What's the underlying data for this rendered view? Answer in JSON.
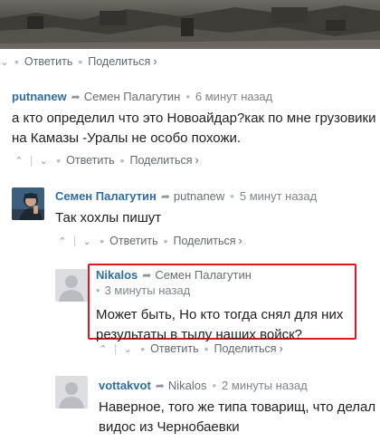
{
  "top_actions": {
    "reply": "Ответить",
    "share": "Поделиться"
  },
  "comments": [
    {
      "author": "putnanew",
      "reply_to": "Семен Палагутин",
      "time": "6 минут назад",
      "text_lines": [
        "а кто определил что это Новоайдар?как по мне грузовики",
        "на Камазы -Уралы не особо похожи."
      ],
      "reply": "Ответить",
      "share": "Поделиться"
    },
    {
      "author": "Семен Палагутин",
      "reply_to": "putnanew",
      "time": "5 минут назад",
      "text_lines": [
        "Так хохлы пишут"
      ],
      "reply": "Ответить",
      "share": "Поделиться"
    },
    {
      "author": "Nikalos",
      "reply_to": "Семен Палагутин",
      "time": "3 минуты назад",
      "text_lines": [
        "Может быть, Но кто тогда снял для них",
        "результаты в тылу наших войск?"
      ],
      "reply": "Ответить",
      "share": "Поделиться"
    },
    {
      "author": "vottakvot",
      "reply_to": "Nikalos",
      "time": "2 минуты назад",
      "text_lines": [
        "Наверное, того же типа товарищ, что делал",
        "видос из Чернобаевки"
      ]
    }
  ],
  "colors": {
    "author": "#2e6da4",
    "highlight": "#e2171e",
    "muted": "#7d868d"
  },
  "icons": {
    "upvote": "chevron-up-icon",
    "downvote": "chevron-down-icon",
    "reply_arrow": "reply-arrow-icon",
    "share_chevron": "chevron-right-icon"
  }
}
